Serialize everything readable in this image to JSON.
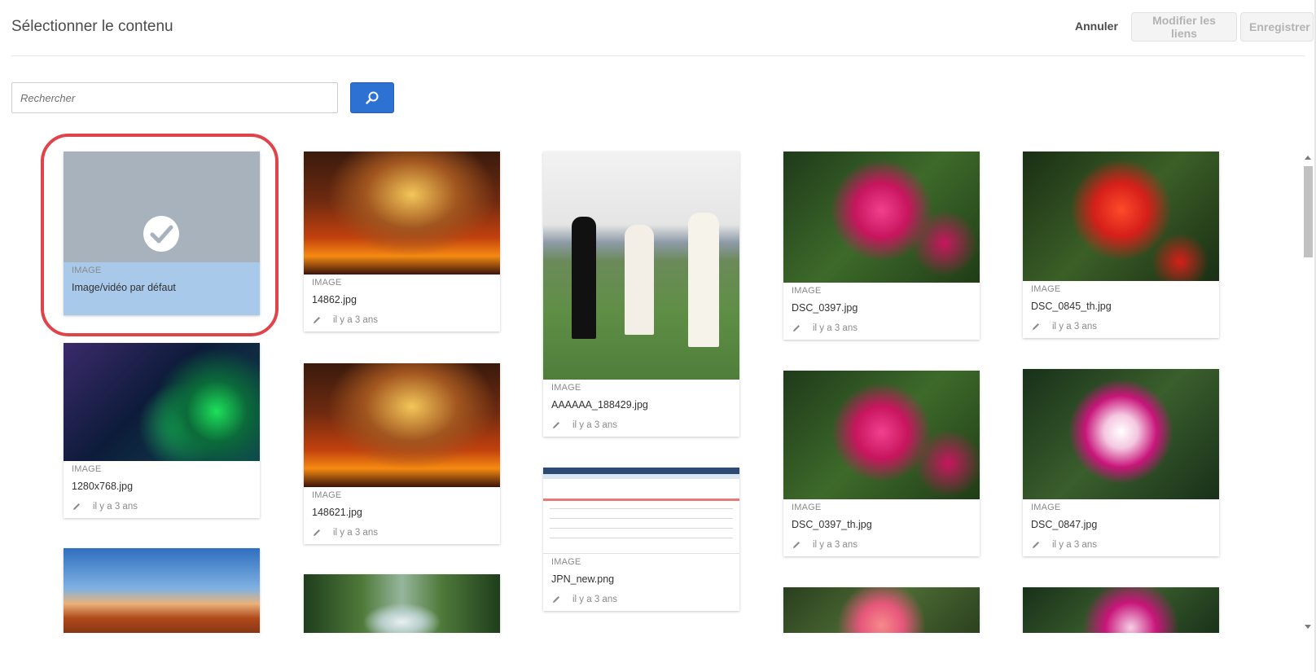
{
  "header": {
    "title": "Sélectionner le contenu",
    "cancel_label": "Annuler",
    "modify_links_label": "Modifier les liens",
    "save_label": "Enregistrer"
  },
  "search": {
    "placeholder": "Rechercher",
    "value": ""
  },
  "colors": {
    "accent": "#2d72d2",
    "selection": "#a9c9ea",
    "highlight_ring": "#e0434a"
  },
  "items": [
    {
      "type": "IMAGE",
      "name": "Image/vidéo par défaut",
      "edited": "",
      "selected": true,
      "icon": "checkmark-circle-icon"
    },
    {
      "type": "IMAGE",
      "name": "14862.jpg",
      "edited": "il y a 3 ans"
    },
    {
      "type": "IMAGE",
      "name": "AAAAAA_188429.jpg",
      "edited": "il y a 3 ans"
    },
    {
      "type": "IMAGE",
      "name": "DSC_0397.jpg",
      "edited": "il y a 3 ans"
    },
    {
      "type": "IMAGE",
      "name": "DSC_0845_th.jpg",
      "edited": "il y a 3 ans"
    },
    {
      "type": "IMAGE",
      "name": "1280x768.jpg",
      "edited": "il y a 3 ans"
    },
    {
      "type": "IMAGE",
      "name": "148621.jpg",
      "edited": "il y a 3 ans"
    },
    {
      "type": "IMAGE",
      "name": "JPN_new.png",
      "edited": "il y a 3 ans"
    },
    {
      "type": "IMAGE",
      "name": "DSC_0397_th.jpg",
      "edited": "il y a 3 ans"
    },
    {
      "type": "IMAGE",
      "name": "DSC_0847.jpg",
      "edited": "il y a 3 ans"
    }
  ]
}
